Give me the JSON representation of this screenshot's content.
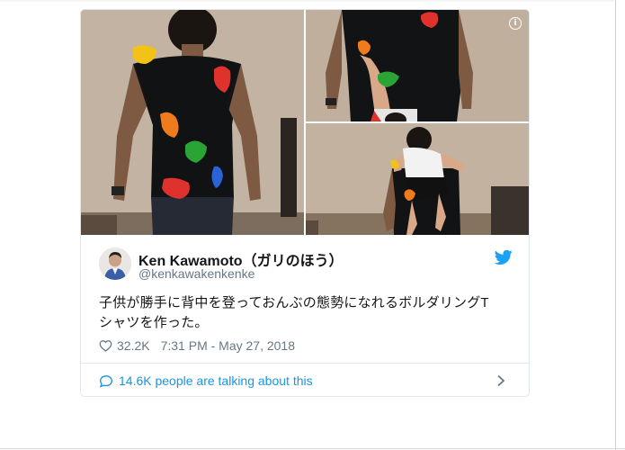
{
  "tweet": {
    "display_name": "Ken Kawamoto（ガリのほう）",
    "handle": "@kenkawakenkenke",
    "text_line1": "子供が勝手に背中を登っておんぶの態勢になれるボルダリングT",
    "text_line2": "シャツを作った。",
    "likes": "32.2K",
    "timestamp": "7:31 PM - May 27, 2018",
    "conversation_text": "14.6K people are talking about this"
  },
  "icons": {
    "info": "info-icon",
    "twitter": "twitter-bird-icon",
    "like": "heart-icon",
    "reply": "speech-bubble-icon",
    "chevron": "chevron-right-icon"
  },
  "colors": {
    "twitter_blue": "#1da1f2",
    "link_blue": "#1b95e0",
    "text": "#14171a",
    "muted": "#657786"
  },
  "info_glyph": "i"
}
